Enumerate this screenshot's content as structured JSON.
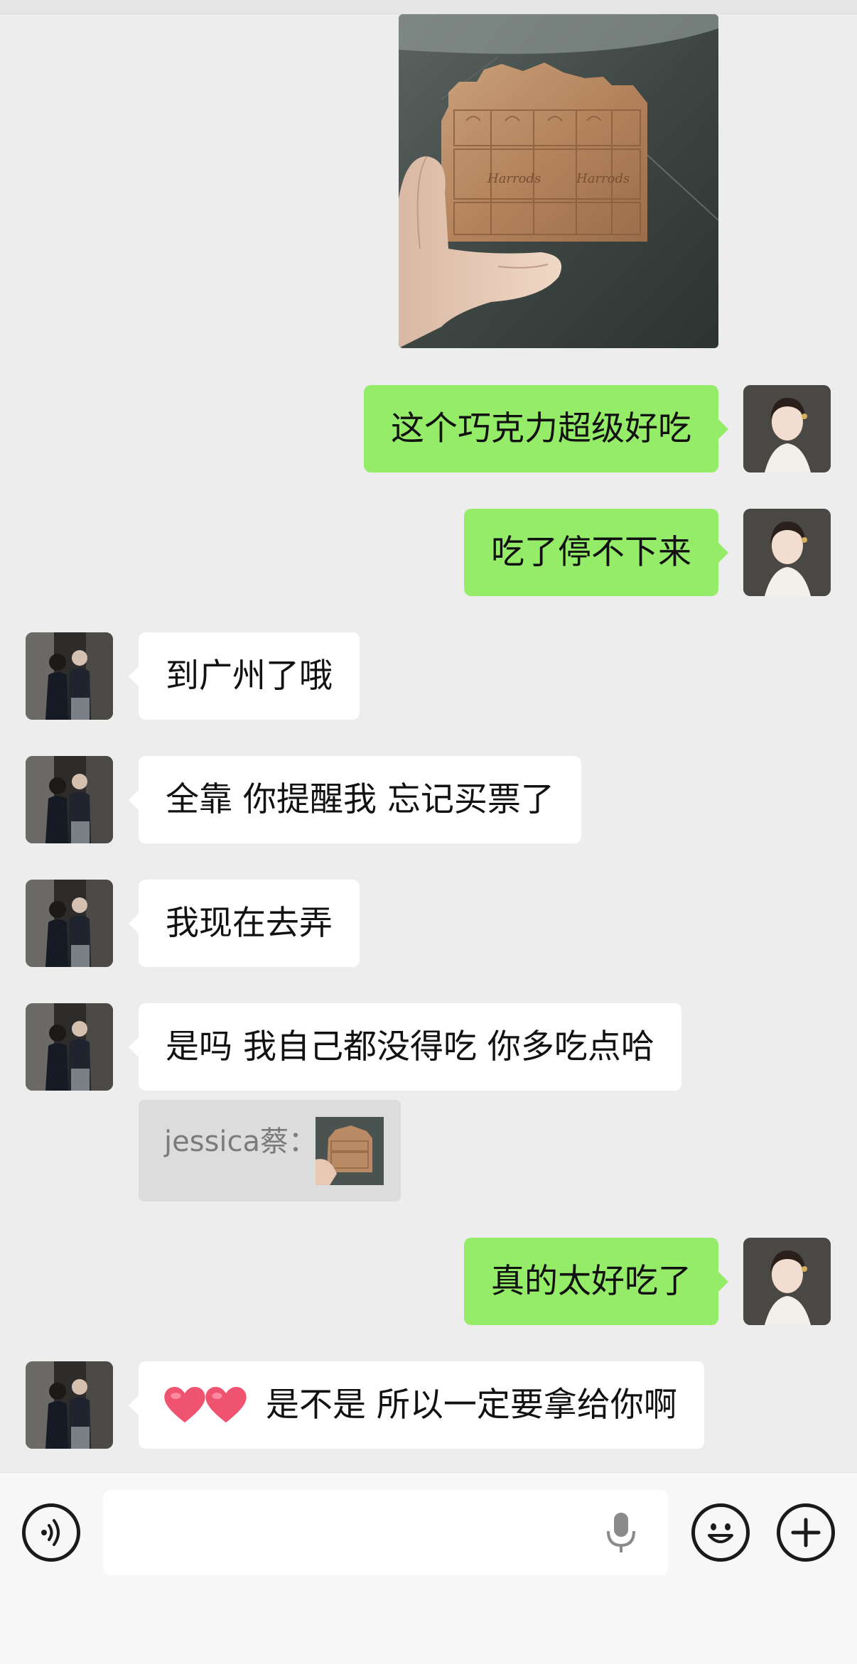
{
  "chat": {
    "messages": [
      {
        "sender": "me",
        "type": "image",
        "alt": "Harrods chocolate photo"
      },
      {
        "sender": "me",
        "type": "text",
        "text": "这个巧克力超级好吃"
      },
      {
        "sender": "me",
        "type": "text",
        "text": "吃了停不下来"
      },
      {
        "sender": "friend",
        "type": "text",
        "text": "到广州了哦"
      },
      {
        "sender": "friend",
        "type": "text",
        "text": "全靠 你提醒我 忘记买票了"
      },
      {
        "sender": "friend",
        "type": "text",
        "text": "我现在去弄"
      },
      {
        "sender": "friend",
        "type": "text",
        "text": "是吗 我自己都没得吃 你多吃点哈"
      },
      {
        "sender": "me",
        "type": "text",
        "text": "真的太好吃了"
      },
      {
        "sender": "friend",
        "type": "text",
        "text": "是不是 所以一定要拿给你啊",
        "prefix_emoji": "heart-heart"
      }
    ],
    "quote": {
      "name": "jessica蔡："
    },
    "photo_label": "Harrods"
  },
  "input_bar": {
    "value": "",
    "icons": [
      "voice-icon",
      "microphone-icon",
      "emoji-icon",
      "plus-icon"
    ]
  },
  "colors": {
    "background": "#ededed",
    "outgoing_bubble": "#95ec69",
    "incoming_bubble": "#ffffff"
  }
}
